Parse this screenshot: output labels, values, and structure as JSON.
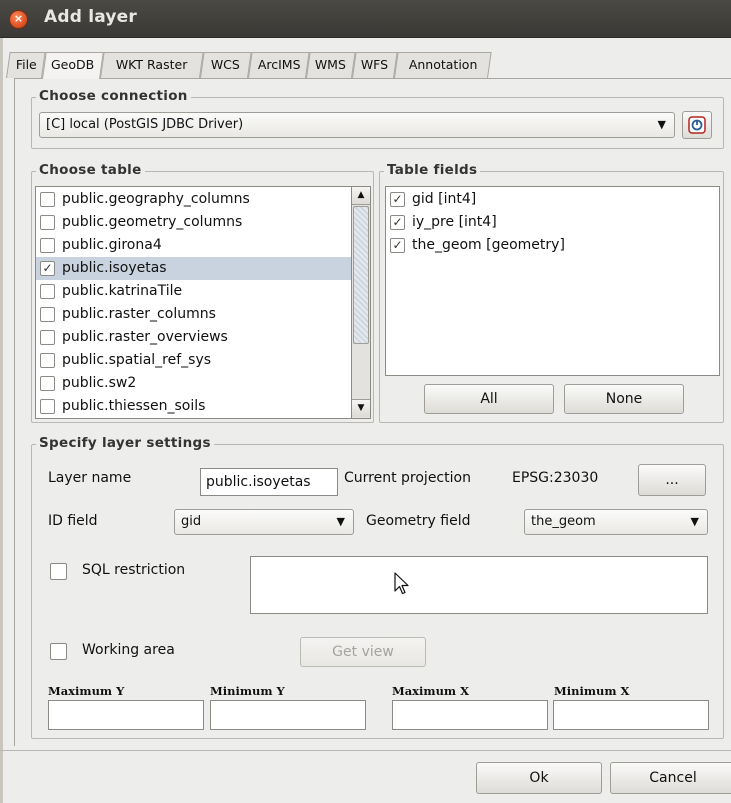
{
  "window": {
    "title": "Add layer",
    "close_glyph": "×"
  },
  "tabs": [
    {
      "label": "File",
      "active": false
    },
    {
      "label": "GeoDB",
      "active": true
    },
    {
      "label": "WKT Raster",
      "active": false
    },
    {
      "label": "WCS",
      "active": false
    },
    {
      "label": "ArcIMS",
      "active": false
    },
    {
      "label": "WMS",
      "active": false
    },
    {
      "label": "WFS",
      "active": false
    },
    {
      "label": "Annotation",
      "active": false
    }
  ],
  "connection": {
    "legend": "Choose connection",
    "selected": "[C] local (PostGIS JDBC Driver)",
    "refresh_icon": "connect-icon"
  },
  "tables": {
    "legend": "Choose table",
    "items": [
      {
        "label": "public.geography_columns",
        "checked": false
      },
      {
        "label": "public.geometry_columns",
        "checked": false
      },
      {
        "label": "public.girona4",
        "checked": false
      },
      {
        "label": "public.isoyetas",
        "checked": true
      },
      {
        "label": "public.katrinaTile",
        "checked": false
      },
      {
        "label": "public.raster_columns",
        "checked": false
      },
      {
        "label": "public.raster_overviews",
        "checked": false
      },
      {
        "label": "public.spatial_ref_sys",
        "checked": false
      },
      {
        "label": "public.sw2",
        "checked": false
      },
      {
        "label": "public.thiessen_soils",
        "checked": false
      }
    ],
    "selected_index": 3
  },
  "fields": {
    "legend": "Table fields",
    "items": [
      {
        "label": "gid [int4]",
        "checked": true
      },
      {
        "label": "iy_pre [int4]",
        "checked": true
      },
      {
        "label": "the_geom [geometry]",
        "checked": true
      }
    ],
    "all_label": "All",
    "none_label": "None"
  },
  "settings": {
    "legend": "Specify layer settings",
    "layer_name_label": "Layer name",
    "layer_name_value": "public.isoyetas",
    "projection_label": "Current projection",
    "projection_value": "EPSG:23030",
    "projection_button": "...",
    "id_field_label": "ID field",
    "id_field_value": "gid",
    "geometry_field_label": "Geometry field",
    "geometry_field_value": "the_geom",
    "sql_label": "SQL restriction",
    "sql_value": "",
    "working_area_label": "Working area",
    "get_view_label": "Get view",
    "max_y_label": "Maximum Y",
    "min_y_label": "Minimum Y",
    "max_x_label": "Maximum X",
    "min_x_label": "Minimum X"
  },
  "footer": {
    "ok_label": "Ok",
    "cancel_label": "Cancel"
  },
  "colors": {
    "titlebar": "#3f3e3a",
    "selection": "#c8d3df",
    "close": "#e2582a"
  }
}
